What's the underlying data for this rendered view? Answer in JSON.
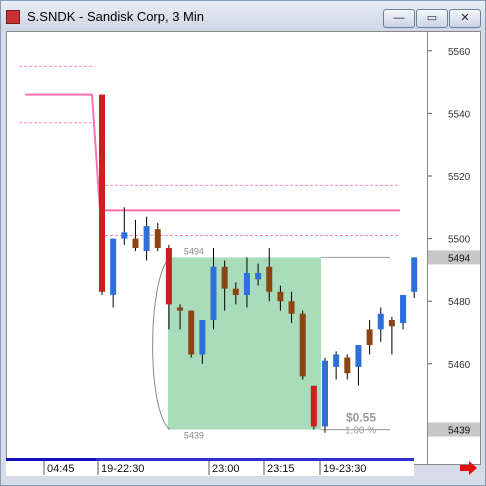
{
  "window": {
    "title": "S.SNDK - Sandisk Corp, 3 Min",
    "buttons": [
      "—",
      "▭",
      "✕"
    ]
  },
  "colors": {
    "up": "#2f6fdc",
    "down": "#cc1f1f",
    "brown": "#8b4513",
    "green_fill": "#9fd8b2",
    "pink": "#ff6fb4",
    "pink_dashed": "#ff88c8"
  },
  "chart_data": {
    "type": "candlestick",
    "title": "S.SNDK - Sandisk Corp, 3 Min",
    "yaxis": {
      "ylim": [
        54.28,
        55.66
      ],
      "ticks": [
        "5560",
        "5540",
        "5520",
        "5500",
        "5480",
        "5460"
      ],
      "tick_values": [
        55.6,
        55.4,
        55.2,
        55.0,
        54.8,
        54.6
      ],
      "last_price_label": "5494",
      "low_label": "5439"
    },
    "xaxis": {
      "tick_labels": [
        "04:45",
        "19-22:30",
        "23:00",
        "23:15",
        "19-23:30"
      ]
    },
    "reference_lines": [
      {
        "style": "dashed",
        "value": 55.55
      },
      {
        "style": "dashed",
        "value": 55.37
      },
      {
        "style": "solid",
        "value": 55.46
      },
      {
        "style": "dashed",
        "value": 55.17
      },
      {
        "style": "solid",
        "value": 55.09
      },
      {
        "style": "dashed",
        "value": 55.01
      }
    ],
    "candles": [
      {
        "o": 55.46,
        "h": 55.46,
        "l": 54.82,
        "c": 54.83,
        "dir": "down"
      },
      {
        "o": 54.82,
        "h": 55.0,
        "l": 54.78,
        "c": 55.0,
        "dir": "up"
      },
      {
        "o": 55.0,
        "h": 55.1,
        "l": 54.98,
        "c": 55.02,
        "dir": "up"
      },
      {
        "o": 55.0,
        "h": 55.06,
        "l": 54.96,
        "c": 54.97,
        "dir": "brown"
      },
      {
        "o": 54.96,
        "h": 55.07,
        "l": 54.93,
        "c": 55.04,
        "dir": "up"
      },
      {
        "o": 55.03,
        "h": 55.05,
        "l": 54.96,
        "c": 54.97,
        "dir": "brown"
      },
      {
        "o": 54.97,
        "h": 54.98,
        "l": 54.71,
        "c": 54.79,
        "dir": "down"
      },
      {
        "o": 54.77,
        "h": 54.79,
        "l": 54.71,
        "c": 54.78,
        "dir": "brown"
      },
      {
        "o": 54.77,
        "h": 54.77,
        "l": 54.62,
        "c": 54.63,
        "dir": "brown"
      },
      {
        "o": 54.63,
        "h": 54.74,
        "l": 54.6,
        "c": 54.74,
        "dir": "up"
      },
      {
        "o": 54.74,
        "h": 54.97,
        "l": 54.71,
        "c": 54.91,
        "dir": "up"
      },
      {
        "o": 54.91,
        "h": 54.93,
        "l": 54.77,
        "c": 54.84,
        "dir": "brown"
      },
      {
        "o": 54.84,
        "h": 54.86,
        "l": 54.79,
        "c": 54.82,
        "dir": "brown"
      },
      {
        "o": 54.82,
        "h": 54.94,
        "l": 54.78,
        "c": 54.89,
        "dir": "up"
      },
      {
        "o": 54.89,
        "h": 54.92,
        "l": 54.85,
        "c": 54.87,
        "dir": "up"
      },
      {
        "o": 54.91,
        "h": 54.97,
        "l": 54.8,
        "c": 54.83,
        "dir": "brown"
      },
      {
        "o": 54.83,
        "h": 54.85,
        "l": 54.77,
        "c": 54.8,
        "dir": "brown"
      },
      {
        "o": 54.8,
        "h": 54.83,
        "l": 54.73,
        "c": 54.76,
        "dir": "brown"
      },
      {
        "o": 54.76,
        "h": 54.77,
        "l": 54.55,
        "c": 54.56,
        "dir": "brown"
      },
      {
        "o": 54.53,
        "h": 54.53,
        "l": 54.39,
        "c": 54.4,
        "dir": "down"
      },
      {
        "o": 54.4,
        "h": 54.62,
        "l": 54.38,
        "c": 54.61,
        "dir": "up"
      },
      {
        "o": 54.59,
        "h": 54.64,
        "l": 54.55,
        "c": 54.63,
        "dir": "up"
      },
      {
        "o": 54.62,
        "h": 54.63,
        "l": 54.55,
        "c": 54.57,
        "dir": "brown"
      },
      {
        "o": 54.59,
        "h": 54.66,
        "l": 54.53,
        "c": 54.66,
        "dir": "up"
      },
      {
        "o": 54.66,
        "h": 54.74,
        "l": 54.63,
        "c": 54.71,
        "dir": "brown"
      },
      {
        "o": 54.71,
        "h": 54.78,
        "l": 54.67,
        "c": 54.76,
        "dir": "up"
      },
      {
        "o": 54.72,
        "h": 54.75,
        "l": 54.63,
        "c": 54.74,
        "dir": "brown"
      },
      {
        "o": 54.73,
        "h": 54.82,
        "l": 54.71,
        "c": 54.82,
        "dir": "up"
      },
      {
        "o": 54.83,
        "h": 54.94,
        "l": 54.81,
        "c": 54.94,
        "dir": "up"
      }
    ],
    "annotation_box": {
      "top_label": "5494",
      "bottom_label": "5439",
      "change_label": "$0.55",
      "percent_label": "1.00 %",
      "y_top": 54.94,
      "y_bottom": 54.39
    }
  }
}
